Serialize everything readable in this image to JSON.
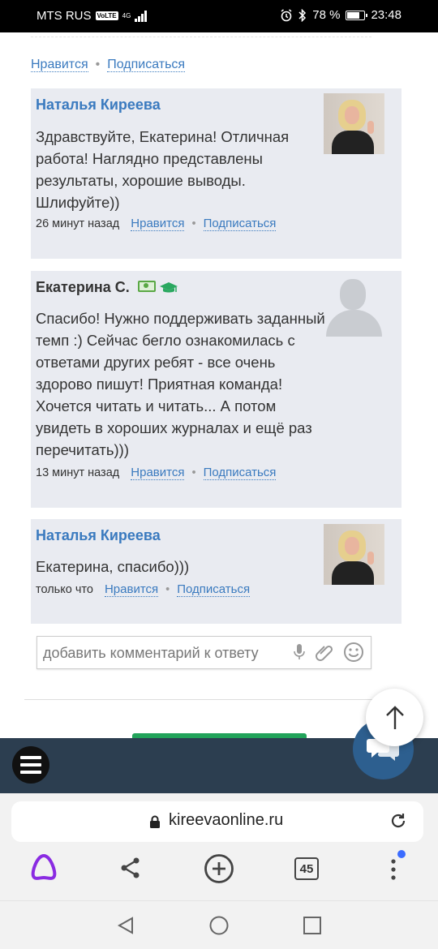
{
  "status_bar": {
    "carrier": "MTS RUS",
    "volte": "VoLTE",
    "network": "4G",
    "battery": "78 %",
    "time": "23:48"
  },
  "top_actions": {
    "like": "Нравится",
    "subscribe": "Подписаться"
  },
  "comments": [
    {
      "author": "Наталья Киреева",
      "text": "Здравствуйте, Екатерина! Отличная работа! Наглядно представлены результаты, хорошие выводы. Шлифуйте))",
      "time": "26 минут назад",
      "like": "Нравится",
      "subscribe": "Подписаться",
      "avatar": "photo"
    },
    {
      "author": "Екатерина С.",
      "text": "Спасибо! Нужно поддерживать заданный темп :) Сейчас бегло ознакомилась с ответами других ребят - все очень здорово пишут! Приятная команда! Хочется читать и читать... А потом увидеть в хороших журналах и ещё раз перечитать)))",
      "time": "13 минут назад",
      "like": "Нравится",
      "subscribe": "Подписаться",
      "avatar": "placeholder"
    },
    {
      "author": "Наталья Киреева",
      "text": "Екатерина, спасибо)))",
      "time": "только что",
      "like": "Нравится",
      "subscribe": "Подписаться",
      "avatar": "photo"
    }
  ],
  "reply": {
    "placeholder": "добавить комментарий к ответу"
  },
  "browser": {
    "url": "kireevaonline.ru",
    "tabs_count": "45"
  },
  "colors": {
    "link": "#3a7abf",
    "comment_bg": "#e9ebf1",
    "site_bar": "#2c3e50",
    "chat_button": "#2d5f8f",
    "green_button": "#22a35a"
  }
}
